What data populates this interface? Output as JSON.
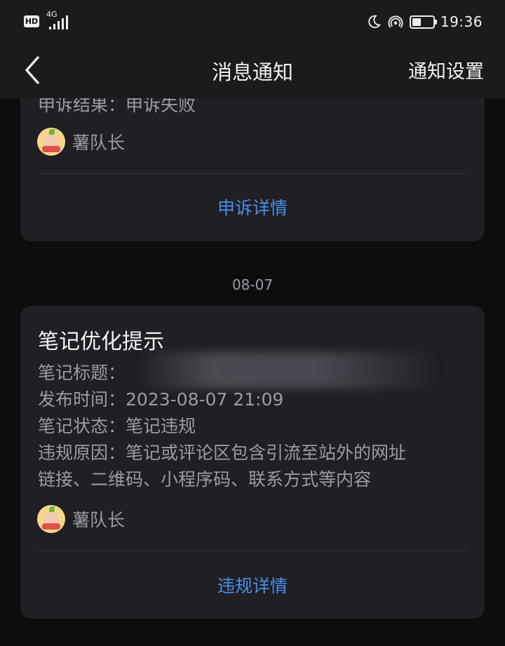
{
  "status_bar": {
    "hd_badge": "HD",
    "network": "4G",
    "time": "19:36",
    "icons": [
      "moon-icon",
      "hotspot-icon",
      "battery-icon"
    ],
    "battery_level": 0.45
  },
  "nav": {
    "title": "消息通知",
    "action": "通知设置",
    "back_icon": "chevron-left-icon"
  },
  "notifications": [
    {
      "partial_line": "申诉结果：申诉失败",
      "author": "薯队长",
      "link": "申诉详情"
    },
    {
      "date": "08-07",
      "title": "笔记优化提示",
      "fields": [
        {
          "label": "笔记标题：",
          "value": ""
        },
        {
          "label": "发布时间：",
          "value": "2023-08-07 21:09"
        },
        {
          "label": "笔记状态：",
          "value": "笔记违规"
        },
        {
          "label": "违规原因：",
          "value": "笔记或评论区包含引流至站外的网址"
        }
      ],
      "reason_continued": "链接、二维码、小程序码、联系方式等内容",
      "author": "薯队长",
      "link": "违规详情"
    }
  ],
  "colors": {
    "background": "#0d0d10",
    "card": "#1f1f24",
    "link": "#4a8fe6",
    "muted_text": "#9b9ba3"
  }
}
